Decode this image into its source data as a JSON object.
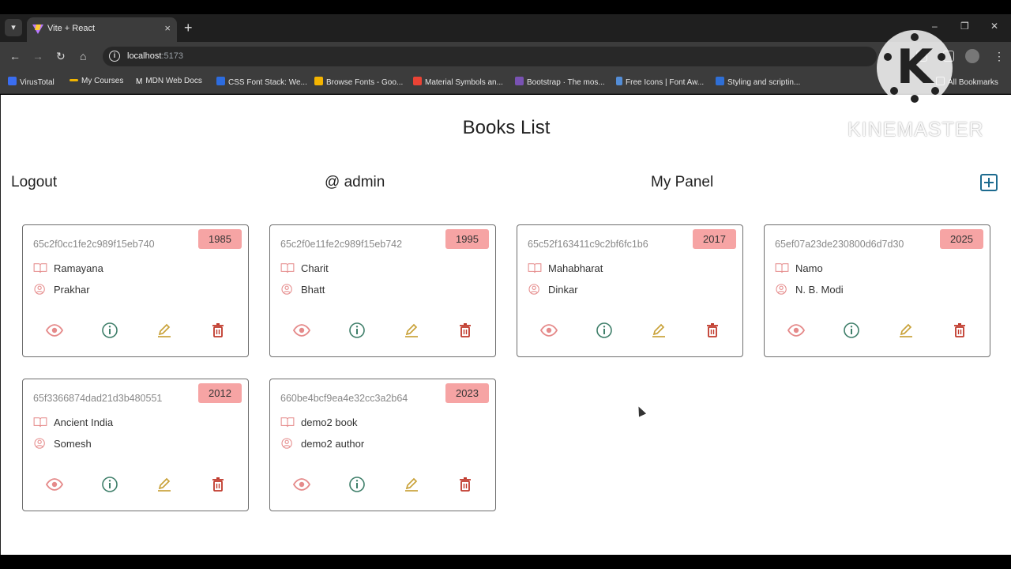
{
  "browser": {
    "tab_title": "Vite + React",
    "tab_close": "×",
    "new_tab": "+",
    "url": "localhost",
    "url_port": ":5173",
    "window_controls": [
      "–",
      "❐",
      "✕"
    ],
    "bookmarks": [
      {
        "label": "VirusTotal",
        "color": "#3a6df0"
      },
      {
        "label": "My Courses",
        "color": "#f0b400"
      },
      {
        "label": "MDN Web Docs",
        "color": "#ffffff"
      },
      {
        "label": "CSS Font Stack: We...",
        "color": "#2d6cdf"
      },
      {
        "label": "Browse Fonts - Goo...",
        "color": "#f4b400"
      },
      {
        "label": "Material Symbols an...",
        "color": "#ea4335"
      },
      {
        "label": "Bootstrap · The mos...",
        "color": "#7952b3"
      },
      {
        "label": "Free Icons | Font Aw...",
        "color": "#538dd7"
      },
      {
        "label": "Styling and scriptin...",
        "color": "#2f6fd6"
      }
    ],
    "all_bookmarks": "All Bookmarks"
  },
  "page": {
    "title": "Books List",
    "logout_label": "Logout",
    "user_label": "@ admin",
    "panel_label": "My Panel"
  },
  "colors": {
    "badge": "#f6a4a4",
    "eye": "#e58a8a",
    "info": "#3f7f6a",
    "edit": "#c9a23a",
    "delete": "#c0392b"
  },
  "books": [
    {
      "id": "65c2f0cc1fe2c989f15eb740",
      "year": "1985",
      "title": "Ramayana",
      "author": "Prakhar"
    },
    {
      "id": "65c2f0e11fe2c989f15eb742",
      "year": "1995",
      "title": "Charit",
      "author": "Bhatt"
    },
    {
      "id": "65c52f163411c9c2bf6fc1b6",
      "year": "2017",
      "title": "Mahabharat",
      "author": "Dinkar"
    },
    {
      "id": "65ef07a23de230800d6d7d30",
      "year": "2025",
      "title": "Namo",
      "author": "N. B. Modi"
    },
    {
      "id": "65f3366874dad21d3b480551",
      "year": "2012",
      "title": "Ancient India",
      "author": "Somesh"
    },
    {
      "id": "660be4bcf9ea4e32cc3a2b64",
      "year": "2023",
      "title": "demo2 book",
      "author": "demo2 author"
    }
  ],
  "watermark": {
    "logo_letter": "K",
    "text": "KINEMASTER"
  }
}
